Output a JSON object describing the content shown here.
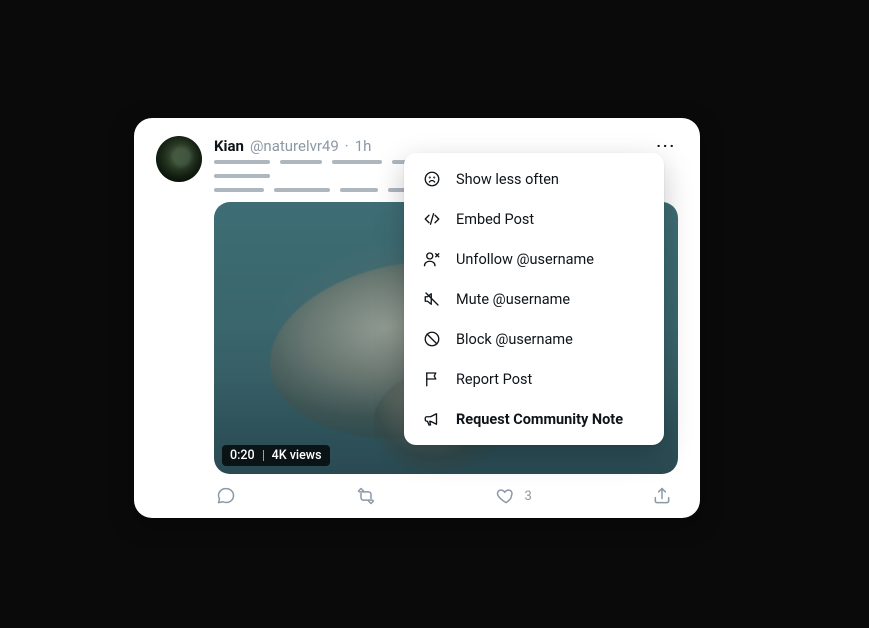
{
  "post": {
    "display_name": "Kian",
    "username": "@naturelvr49",
    "time_separator": "·",
    "time": "1h",
    "video_duration": "0:20",
    "views_label": "4K views"
  },
  "actions": {
    "like_count": "3"
  },
  "menu": {
    "show_less": "Show less often",
    "embed": "Embed Post",
    "unfollow": "Unfollow @username",
    "mute": "Mute @username",
    "block": "Block @username",
    "report": "Report Post",
    "request_note": "Request Community Note"
  }
}
